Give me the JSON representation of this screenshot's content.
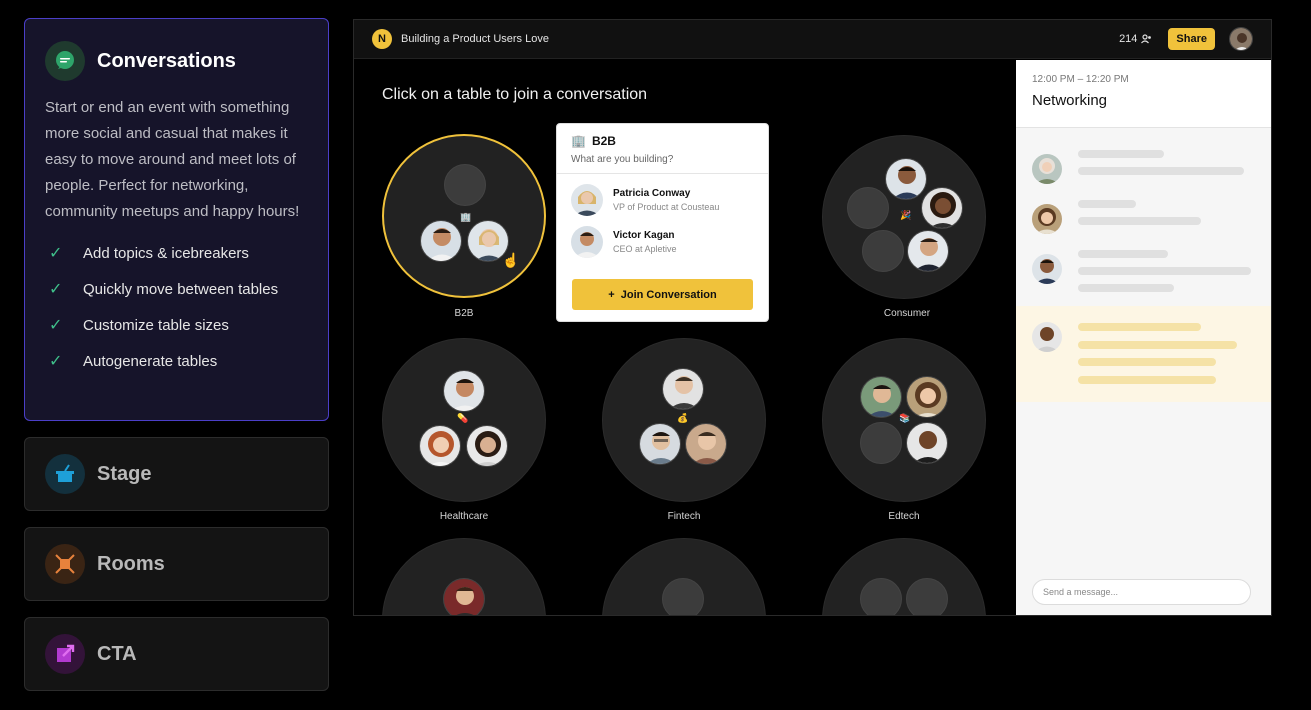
{
  "features": {
    "active": {
      "title": "Conversations",
      "description": "Start or end an event with something more social and casual that makes it easy to move around and meet lots of people. Perfect for networking, community meetups and happy hours!",
      "checklist": [
        "Add topics & icebreakers",
        "Quickly move between tables",
        "Customize table sizes",
        "Autogenerate tables"
      ]
    },
    "collapsed": [
      {
        "title": "Stage",
        "icon": "podium-icon",
        "color": "#1ea0d8"
      },
      {
        "title": "Rooms",
        "icon": "rooms-icon",
        "color": "#e8823c"
      },
      {
        "title": "CTA",
        "icon": "external-link-icon",
        "color": "#b33ad1"
      }
    ]
  },
  "app": {
    "logo": "N",
    "event_title": "Building a Product Users Love",
    "attendee_count": "214",
    "share_label": "Share"
  },
  "stage": {
    "heading": "Click on a table to join a conversation",
    "tables": [
      "B2B",
      "Consumer",
      "Healthcare",
      "Fintech",
      "Edtech"
    ]
  },
  "popover": {
    "title": "B2B",
    "question": "What are you building?",
    "people": [
      {
        "name": "Patricia Conway",
        "role": "VP of Product at Cousteau"
      },
      {
        "name": "Victor Kagan",
        "role": "CEO at Apletive"
      }
    ],
    "join_label": "Join Conversation"
  },
  "chat": {
    "time": "12:00 PM – 12:20 PM",
    "title": "Networking",
    "input_placeholder": "Send a message..."
  },
  "colors": {
    "accent": "#f0c23b",
    "active_border": "#4b3fc8",
    "check": "#3fbf8a"
  }
}
